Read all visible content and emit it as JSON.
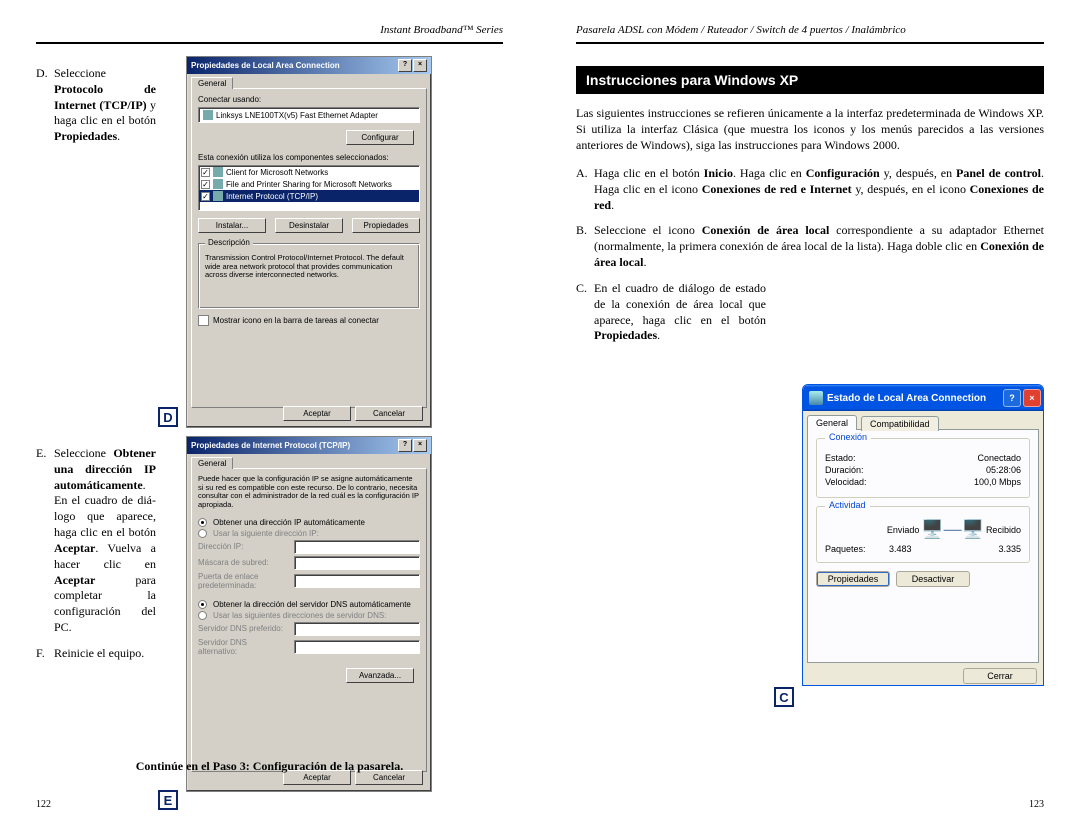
{
  "left": {
    "running_head": "Instant Broadband™ Series",
    "D": {
      "marker": "D.",
      "text_parts": [
        "Seleccione ",
        "Protocolo de Internet (TCP/IP)",
        " y haga clic en el botón ",
        "Propiedades",
        "."
      ]
    },
    "E": {
      "marker": "E.",
      "text_parts": [
        "Seleccione ",
        "Obtener una dirección IP automática­mente",
        ". En el cuadro de diá­logo que aparece, haga clic en el botón ",
        "Aceptar",
        ". Vuelva a hacer clic en ",
        "Aceptar",
        " para completar la configuración del PC."
      ]
    },
    "F": {
      "marker": "F.",
      "text": "Reinicie el equipo."
    },
    "continue": "Continúe en el Paso 3: Configuración de la pasarela.",
    "page_num": "122",
    "letter_D": "D",
    "letter_E": "E",
    "dlg_d": {
      "title": "Propiedades de Local Area Connection",
      "tab": "General",
      "connect_using_label": "Conectar usando:",
      "adapter": "Linksys LNE100TX(v5) Fast Ethernet Adapter",
      "configure": "Configurar",
      "components_label": "Esta conexión utiliza los componentes seleccionados:",
      "items": [
        "Client for Microsoft Networks",
        "File and Printer Sharing for Microsoft Networks",
        "Internet Protocol (TCP/IP)"
      ],
      "install": "Instalar...",
      "uninstall": "Desinstalar",
      "properties": "Propiedades",
      "desc_label": "Descripción",
      "desc": "Transmission Control Protocol/Internet Protocol. The default wide area network protocol that provides communication across diverse interconnected networks.",
      "show_icon": "Mostrar icono en la barra de tareas al conectar",
      "ok": "Aceptar",
      "cancel": "Cancelar"
    },
    "dlg_e": {
      "title": "Propiedades de Internet Protocol (TCP/IP)",
      "tab": "General",
      "intro": "Puede hacer que la configuración IP se asigne automáticamente si su red es compatible con este recurso. De lo contrario, necesita consultar con el administrador de la red cuál es la configuración IP apropiada.",
      "r_auto": "Obtener una dirección IP automáticamente",
      "r_manual": "Usar la siguiente dirección IP:",
      "f_ip": "Dirección IP:",
      "f_mask": "Máscara de subred:",
      "f_gw": "Puerta de enlace predeterminada:",
      "r_dns_auto": "Obtener la dirección del servidor DNS automáticamente",
      "r_dns_manual": "Usar las siguientes direcciones de servidor DNS:",
      "f_dns1": "Servidor DNS preferido:",
      "f_dns2": "Servidor DNS alternativo:",
      "advanced": "Avanzada...",
      "ok": "Aceptar",
      "cancel": "Cancelar"
    }
  },
  "right": {
    "running_head": "Pasarela ADSL con Módem / Ruteador / Switch de 4 puertos / Inalámbrico",
    "section_title": "Instrucciones para Windows XP",
    "intro": "Las siguientes instrucciones se refieren únicamente a la interfaz predetermina­da de Windows XP. Si utiliza la interfaz Clásica (que muestra los iconos y los menús parecidos a las versiones anteriores de Windows), siga las instrucciones para Windows 2000.",
    "A": {
      "marker": "A.",
      "parts": [
        "Haga clic en el botón ",
        "Inicio",
        ". Haga clic en ",
        "Configuración",
        " y, después, en ",
        "Panel de control",
        ". Haga clic en el icono ",
        "Conexiones de red e Internet",
        " y, después, en el icono ",
        "Conexiones de red",
        "."
      ]
    },
    "B": {
      "marker": "B.",
      "parts": [
        "Seleccione el icono ",
        "Conexión de área local",
        " correspondiente a su adapta­dor Ethernet (normalmente, la primera conexión de área local de la lista). Haga doble clic en ",
        "Conexión de área local",
        "."
      ]
    },
    "C": {
      "marker": "C.",
      "parts": [
        "En el cuadro de diálogo de estado de la conexión de área local que aparece, haga clic en el botón ",
        "Propiedades",
        "."
      ]
    },
    "page_num": "123",
    "letter_C": "C",
    "dlg_c": {
      "title": "Estado de Local Area Connection",
      "tab1": "General",
      "tab2": "Compatibilidad",
      "g_conn": "Conexión",
      "estado_l": "Estado:",
      "estado_v": "Conectado",
      "dur_l": "Duración:",
      "dur_v": "05:28:06",
      "vel_l": "Velocidad:",
      "vel_v": "100,0 Mbps",
      "g_act": "Actividad",
      "sent": "Enviado",
      "recv": "Recibido",
      "pkt_l": "Paquetes:",
      "pkt_sent": "3.483",
      "pkt_recv": "3.335",
      "properties": "Propiedades",
      "disable": "Desactivar",
      "close": "Cerrar"
    }
  }
}
